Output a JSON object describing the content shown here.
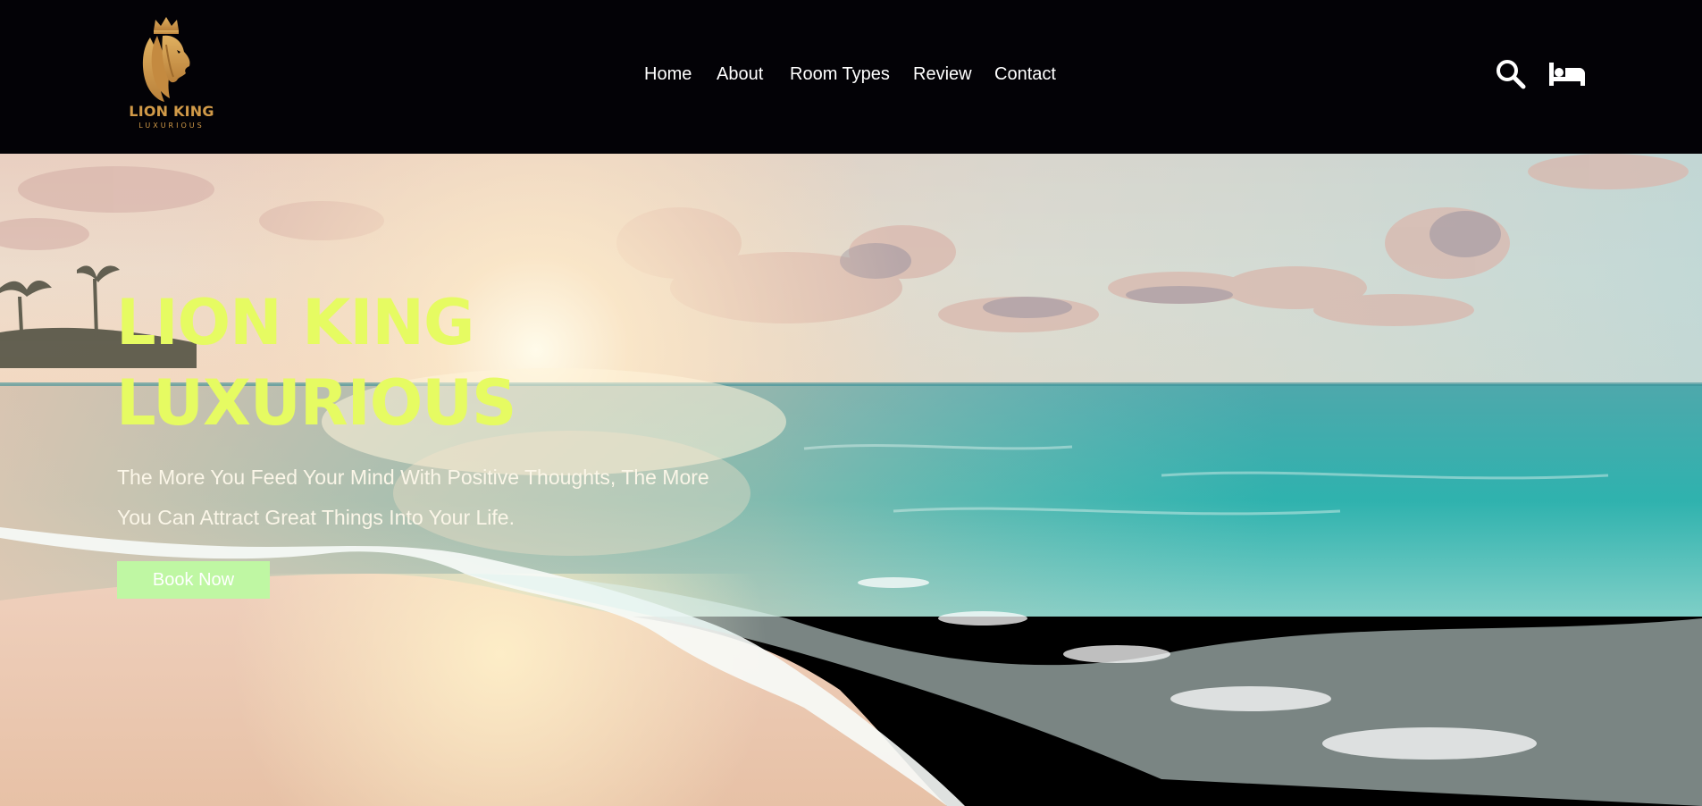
{
  "brand": {
    "name": "LION KING",
    "tagline": "LUXURIOUS"
  },
  "nav": {
    "items": [
      {
        "label": "Home"
      },
      {
        "label": "About"
      },
      {
        "label": "Room Types"
      },
      {
        "label": "Review"
      },
      {
        "label": "Contact"
      }
    ]
  },
  "header_icons": [
    "search-icon",
    "bed-icon"
  ],
  "hero": {
    "title_line1": "LION KING",
    "title_line2": "LUXURIOUS",
    "subtitle_line1": "The More You Feed Your Mind With Positive Thoughts, The More",
    "subtitle_line2": "You Can Attract Great Things Into Your Life.",
    "cta_label": "Book Now"
  },
  "colors": {
    "header_bg": "#030206",
    "nav_text": "#ffffff",
    "logo_gold": "#d19a48",
    "hero_title": "#e6fb62",
    "hero_subtitle": "#fbf6e8",
    "cta_bg": "#bff7a3",
    "cta_text": "#ffffff"
  }
}
